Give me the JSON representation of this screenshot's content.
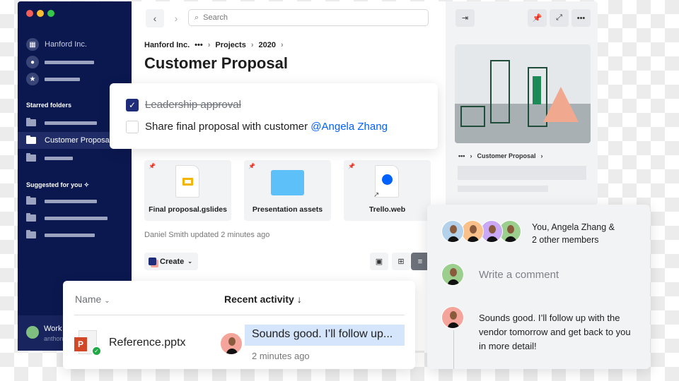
{
  "window": {
    "controls": [
      "close",
      "minimize",
      "maximize"
    ]
  },
  "sidebar": {
    "org": "Hanford Inc.",
    "starred_heading": "Starred folders",
    "starred_active": "Customer Proposal",
    "suggested_heading": "Suggested for you",
    "user_name": "Work",
    "user_email": "anthon"
  },
  "toolbar": {
    "search_placeholder": "Search"
  },
  "breadcrumb": {
    "items": [
      "Hanford Inc.",
      "•••",
      "Projects",
      "2020"
    ]
  },
  "page_title": "Customer Proposal",
  "checklist": {
    "items": [
      {
        "label": "Leadership approval",
        "checked": true
      },
      {
        "label": "Share final proposal with customer",
        "checked": false,
        "mention": "@Angela Zhang"
      }
    ]
  },
  "files": [
    {
      "name": "Final proposal.gslides",
      "icon": "slides-icon"
    },
    {
      "name": "Presentation assets",
      "icon": "folder-icon"
    },
    {
      "name": "Trello.web",
      "icon": "web-link-icon"
    }
  ],
  "updated": "Daniel Smith updated 2 minutes ago",
  "create_label": "Create",
  "table": {
    "col_name": "Name",
    "col_activity": "Recent activity",
    "rows": [
      {
        "name": "Reference.pptx",
        "comment": "Sounds good. I’ll follow up...",
        "time": "2 minutes ago"
      }
    ]
  },
  "preview": {
    "breadcrumb_more": "•••",
    "breadcrumb_folder": "Customer Proposal"
  },
  "comments": {
    "members": "You, Angela Zhang &",
    "members_more": "2 other members",
    "placeholder": "Write a comment",
    "message": "Sounds good. I’ll follow up with the vendor tomorrow and get back to you in more detail!"
  },
  "colors": {
    "sidebar": "#0b1850",
    "accent": "#0061fe",
    "checkbox": "#1e2c7a",
    "highlight": "#d5e5fb"
  }
}
